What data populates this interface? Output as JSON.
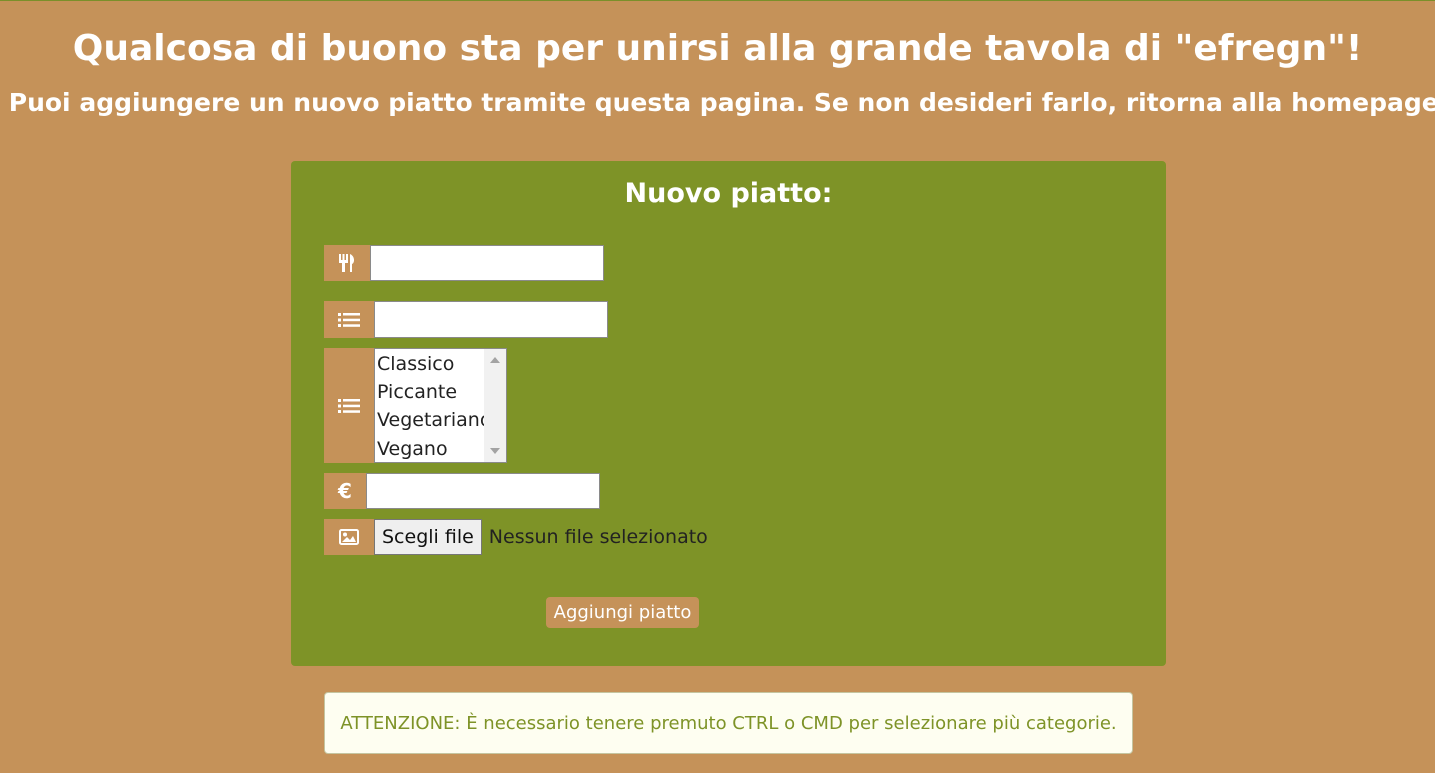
{
  "header": {
    "title": "Qualcosa di buono sta per unirsi alla grande tavola di \"efregn\"!",
    "subtitle_prefix": "Puoi aggiungere un nuovo piatto tramite questa pagina. Se non desideri farlo,",
    "subtitle_link": "ritorna alla homepage",
    "subtitle_suffix": "."
  },
  "form": {
    "title": "Nuovo piatto:",
    "name_field": {
      "value": "",
      "icon": "utensils-icon"
    },
    "description_field": {
      "value": "",
      "icon": "list-icon"
    },
    "categories": {
      "icon": "list-icon",
      "options": [
        "Classico",
        "Piccante",
        "Vegetariano",
        "Vegano"
      ]
    },
    "price_field": {
      "value": "",
      "icon_glyph": "€"
    },
    "image_field": {
      "icon": "image-icon",
      "button_label": "Scegli file",
      "status": "Nessun file selezionato"
    },
    "submit_label": "Aggiungi piatto"
  },
  "alert": {
    "text": "ATTENZIONE: È necessario tenere premuto CTRL o CMD per selezionare più categorie."
  },
  "colors": {
    "background": "#c59259",
    "panel": "#7e9327",
    "alert_bg": "#fefef1",
    "alert_text": "#7e9327"
  }
}
